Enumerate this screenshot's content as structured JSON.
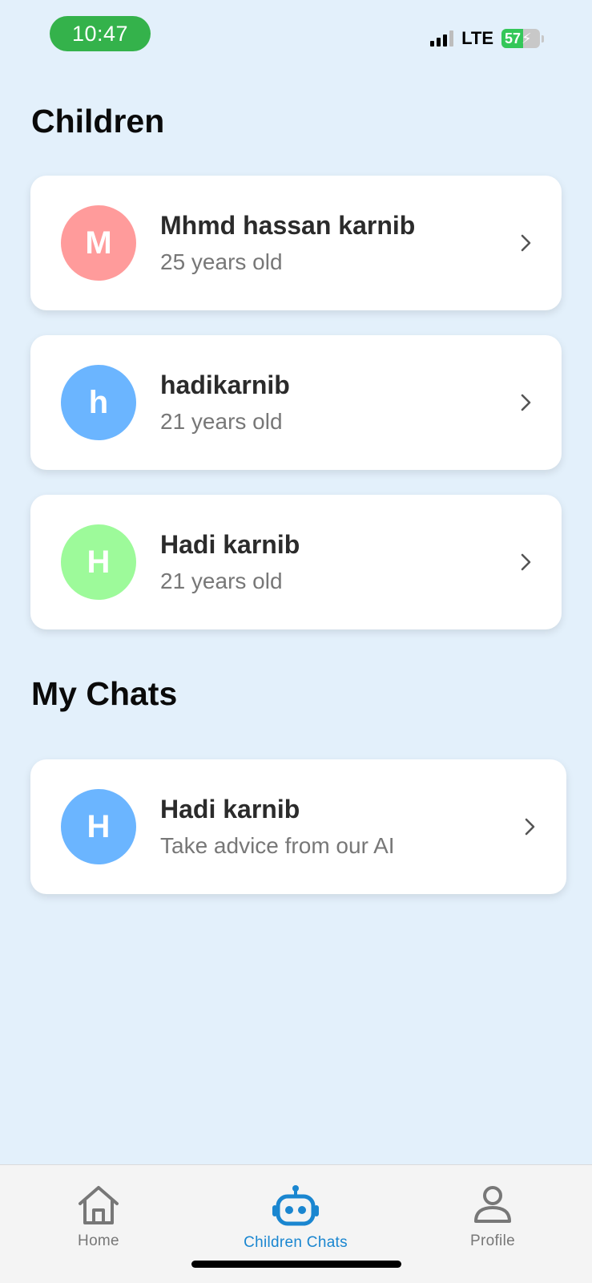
{
  "status_bar": {
    "time": "10:47",
    "network": "LTE",
    "battery_level": "57",
    "battery_percent": 57,
    "time_pill_color": "#34b24b"
  },
  "children_section": {
    "title": "Children",
    "items": [
      {
        "initial": "M",
        "name": "Mhmd hassan karnib",
        "age": "25 years old",
        "avatar_color": "#ff9b9b"
      },
      {
        "initial": "h",
        "name": "hadikarnib",
        "age": "21 years old",
        "avatar_color": "#6bb5ff"
      },
      {
        "initial": "H",
        "name": "Hadi karnib",
        "age": "21 years old",
        "avatar_color": "#9dfa9a"
      }
    ]
  },
  "chats_section": {
    "title": "My Chats",
    "items": [
      {
        "initial": "H",
        "name": "Hadi karnib",
        "subtitle": "Take advice from our AI",
        "avatar_color": "#6bb5ff"
      }
    ]
  },
  "tab_bar": {
    "tabs": [
      {
        "label": "Home",
        "icon": "home-icon",
        "active": false
      },
      {
        "label": "Children Chats",
        "icon": "robot-icon",
        "active": true
      },
      {
        "label": "Profile",
        "icon": "person-icon",
        "active": false
      }
    ],
    "active_color": "#1a86d0",
    "inactive_color": "#777777"
  },
  "colors": {
    "background": "#e3f0fb",
    "card": "#ffffff"
  }
}
